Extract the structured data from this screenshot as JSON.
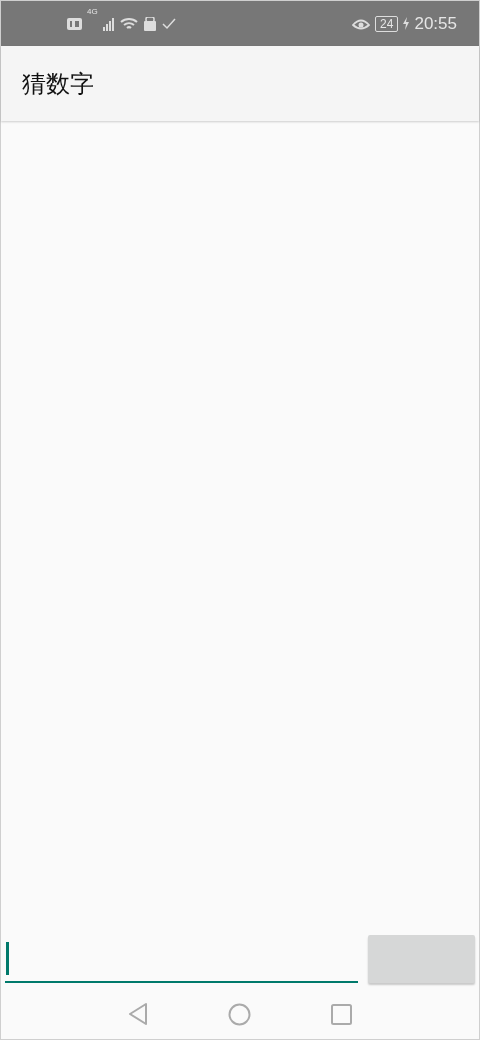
{
  "status_bar": {
    "network": "4G",
    "battery": "24",
    "time": "20:55"
  },
  "app_bar": {
    "title": "猜数字"
  },
  "guess_input": {
    "focused": true
  },
  "guess_button": {
    "disabled": true
  }
}
